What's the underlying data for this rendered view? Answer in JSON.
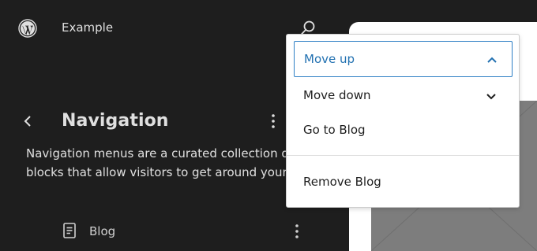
{
  "header": {
    "site_title": "Example",
    "logo_icon": "wordpress-logo-icon",
    "search_icon": "search-icon"
  },
  "sidebar": {
    "back_icon": "chevron-left-icon",
    "title": "Navigation",
    "description_lines": [
      "Navigation menus are a curated collection of",
      "blocks that allow visitors to get around your site"
    ],
    "items": [
      {
        "label": "Blog",
        "icon": "page-icon",
        "more_icon": "more-vertical-icon"
      }
    ]
  },
  "menu": {
    "items": [
      {
        "label": "Move up",
        "icon": "chevron-up-icon",
        "focused": true
      },
      {
        "label": "Move down",
        "icon": "chevron-down-icon"
      },
      {
        "label": "Go to Blog"
      },
      {
        "label": "Remove Blog"
      }
    ]
  },
  "colors": {
    "background": "#1e1e1e",
    "accent": "#2271b1",
    "canvas": "#ffffff"
  }
}
